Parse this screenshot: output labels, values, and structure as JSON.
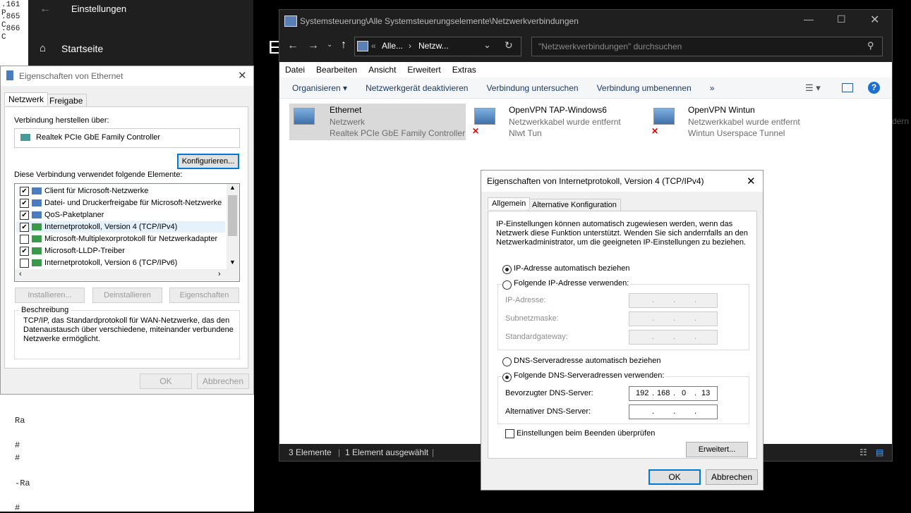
{
  "bg_text": {
    "lines": [
      ".161  P",
      ".865  C",
      ".866  C"
    ],
    "bottom_lines": [
      "Ra",
      "# ",
      "# ",
      "-Ra",
      "# "
    ]
  },
  "settings": {
    "title": "Einstellungen",
    "home_label": "Startseite",
    "big_letter": "E"
  },
  "explorer": {
    "title": "Systemsteuerung\\Alle Systemsteuerungselemente\\Netzwerkverbindungen",
    "address": {
      "prefix": "«",
      "crumb1": "Alle...",
      "sep": "›",
      "crumb2": "Netzw..."
    },
    "search_placeholder": "\"Netzwerkverbindungen\" durchsuchen",
    "menu": [
      "Datei",
      "Bearbeiten",
      "Ansicht",
      "Erweitert",
      "Extras"
    ],
    "commands": [
      "Organisieren ▾",
      "Netzwerkgerät deaktivieren",
      "Verbindung untersuchen",
      "Verbindung umbenennen",
      "»"
    ],
    "connections": [
      {
        "name": "Ethernet",
        "status": "Netzwerk",
        "device": "Realtek PCIe GbE Family Controller"
      },
      {
        "name": "OpenVPN TAP-Windows6",
        "status": "Netzwerkkabel wurde entfernt",
        "device": "Nlwt Tun"
      },
      {
        "name": "OpenVPN Wintun",
        "status": "Netzwerkkabel wurde entfernt",
        "device": "Wintun Userspace Tunnel"
      }
    ],
    "status_bar": {
      "count": "3 Elemente",
      "selected": "1 Element ausgewählt"
    },
    "side_text": "dern"
  },
  "eth_dialog": {
    "title": "Eigenschaften von Ethernet",
    "tabs": [
      "Netzwerk",
      "Freigabe"
    ],
    "connect_using_label": "Verbindung herstellen über:",
    "adapter": "Realtek PCIe GbE Family Controller",
    "configure_button": "Konfigurieren...",
    "items_label": "Diese Verbindung verwendet folgende Elemente:",
    "items": [
      {
        "label": "Client für Microsoft-Netzwerke",
        "checked": true
      },
      {
        "label": "Datei- und Druckerfreigabe für Microsoft-Netzwerke",
        "checked": true
      },
      {
        "label": "QoS-Paketplaner",
        "checked": true
      },
      {
        "label": "Internetprotokoll, Version 4 (TCP/IPv4)",
        "checked": true
      },
      {
        "label": "Microsoft-Multiplexorprotokoll für Netzwerkadapter",
        "checked": false
      },
      {
        "label": "Microsoft-LLDP-Treiber",
        "checked": true
      },
      {
        "label": "Internetprotokoll, Version 6 (TCP/IPv6)",
        "checked": false
      }
    ],
    "buttons": {
      "install": "Installieren...",
      "uninstall": "Deinstallieren",
      "properties": "Eigenschaften"
    },
    "description_label": "Beschreibung",
    "description": "TCP/IP, das Standardprotokoll für WAN-Netzwerke, das den Datenaustausch über verschiedene, miteinander verbundene Netzwerke ermöglicht.",
    "ok": "OK",
    "cancel": "Abbrechen"
  },
  "ipv4_dialog": {
    "title": "Eigenschaften von Internetprotokoll, Version 4 (TCP/IPv4)",
    "tabs": [
      "Allgemein",
      "Alternative Konfiguration"
    ],
    "intro": "IP-Einstellungen können automatisch zugewiesen werden, wenn das Netzwerk diese Funktion unterstützt. Wenden Sie sich andernfalls an den Netzwerkadministrator, um die geeigneten IP-Einstellungen zu beziehen.",
    "ip_auto": "IP-Adresse automatisch beziehen",
    "ip_manual": "Folgende IP-Adresse verwenden:",
    "ip_label": "IP-Adresse:",
    "subnet_label": "Subnetzmaske:",
    "gateway_label": "Standardgateway:",
    "dns_auto": "DNS-Serveradresse automatisch beziehen",
    "dns_manual": "Folgende DNS-Serveradressen verwenden:",
    "dns_pref_label": "Bevorzugter DNS-Server:",
    "dns_pref_octets": [
      "192",
      "168",
      "0",
      "13"
    ],
    "dns_alt_label": "Alternativer DNS-Server:",
    "validate_label": "Einstellungen beim Beenden überprüfen",
    "advanced": "Erweitert...",
    "ok": "OK",
    "cancel": "Abbrechen"
  },
  "colors": {
    "accent": "#0078d7",
    "selection": "#cce8ff",
    "dark": "#1f1f1f"
  }
}
